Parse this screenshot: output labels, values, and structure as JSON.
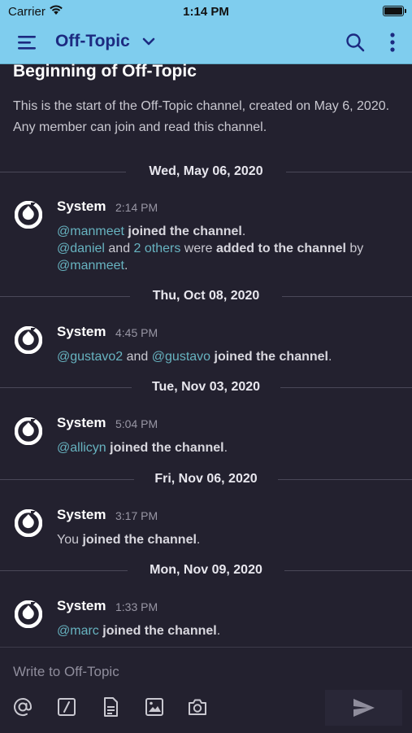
{
  "status_bar": {
    "carrier": "Carrier",
    "time": "1:14 PM"
  },
  "header": {
    "channel_name": "Off-Topic"
  },
  "intro": {
    "title": "Beginning of Off-Topic",
    "text": "This is the start of the Off-Topic channel, created on May 6, 2020.  Any member can join and read this channel."
  },
  "dates": [
    "Wed, May 06, 2020",
    "Thu, Oct 08, 2020",
    "Tue, Nov 03, 2020",
    "Fri, Nov 06, 2020",
    "Mon, Nov 09, 2020"
  ],
  "posts": [
    {
      "author": "System",
      "time": "2:14 PM",
      "mention_a": "@manmeet",
      "text_a": " joined the channel",
      "mention_b": "@daniel",
      "and": " and ",
      "others": "2 others",
      "were": " were ",
      "added": "added to the channel",
      "by": " by",
      "mention_c": "@manmeet"
    },
    {
      "author": "System",
      "time": "4:45 PM",
      "mention_a": "@gustavo2",
      "and": " and ",
      "mention_b": "@gustavo",
      "text_a": "joined the channel"
    },
    {
      "author": "System",
      "time": "5:04 PM",
      "mention_a": "@allicyn",
      "text_a": "joined the channel"
    },
    {
      "author": "System",
      "time": "3:17 PM",
      "you": "You ",
      "text_a": "joined the channel"
    },
    {
      "author": "System",
      "time": "1:33 PM",
      "mention_a": "@marc",
      "text_a": "joined the channel"
    }
  ],
  "composer": {
    "placeholder": "Write to Off-Topic"
  },
  "colors": {
    "header_bg": "#7fcdee",
    "title": "#1c2a80",
    "background": "#23212f",
    "mention": "#67b3c0"
  },
  "icons": [
    "wifi-icon",
    "battery-icon",
    "hamburger-menu-icon",
    "chevron-down-icon",
    "search-icon",
    "more-vertical-icon",
    "mattermost-logo-icon",
    "at-mention-icon",
    "slash-command-icon",
    "file-icon",
    "image-icon",
    "camera-icon",
    "send-icon"
  ]
}
